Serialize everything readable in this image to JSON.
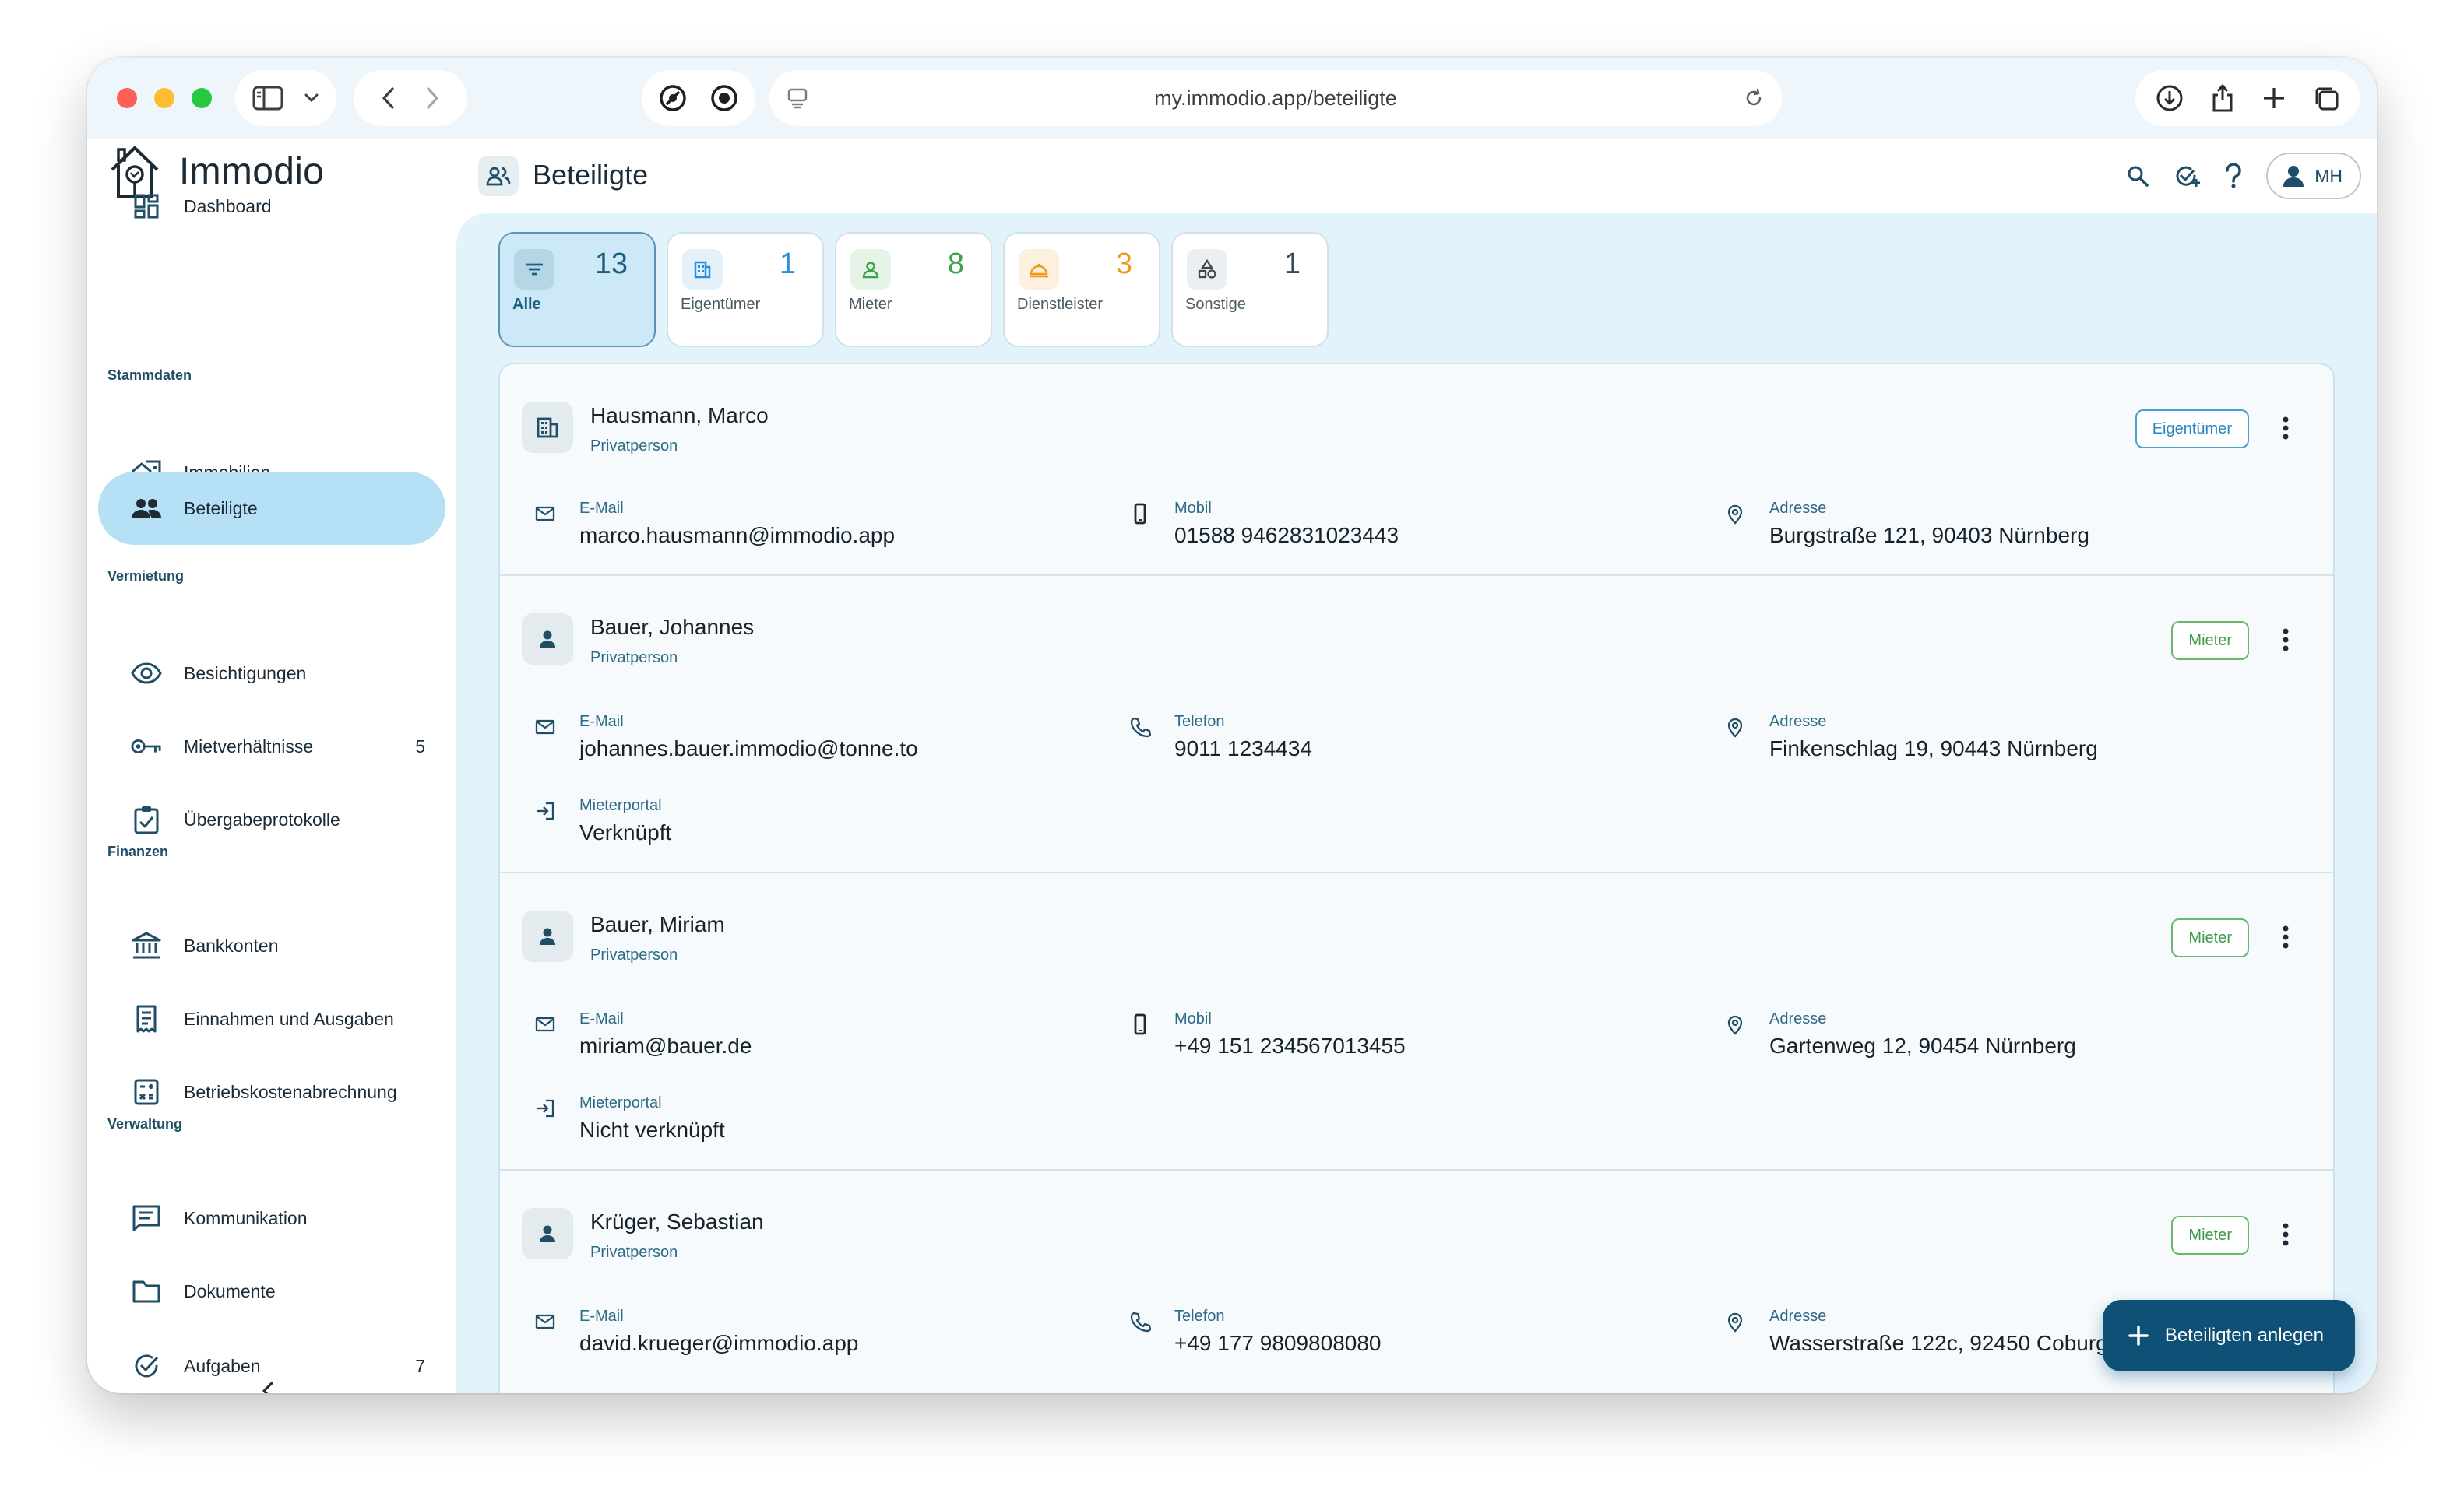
{
  "browser": {
    "url": "my.immodio.app/beteiligte"
  },
  "brand": {
    "name": "Immodio"
  },
  "sidebar": {
    "dashboard": "Dashboard",
    "sections": {
      "stammdaten": "Stammdaten",
      "vermietung": "Vermietung",
      "finanzen": "Finanzen",
      "verwaltung": "Verwaltung"
    },
    "items": {
      "immobilien": "Immobilien",
      "beteiligte": "Beteiligte",
      "besichtigungen": "Besichtigungen",
      "mietverhaeltnisse": "Mietverhältnisse",
      "mietverhaeltnisse_count": "5",
      "uebergabeprotokolle": "Übergabeprotokolle",
      "bankkonten": "Bankkonten",
      "einnahmen": "Einnahmen und Ausgaben",
      "betriebskosten": "Betriebskostenabrechnung",
      "kommunikation": "Kommunikation",
      "dokumente": "Dokumente",
      "aufgaben": "Aufgaben",
      "aufgaben_count": "7"
    }
  },
  "header": {
    "title": "Beteiligte",
    "user_initials": "MH"
  },
  "filters": [
    {
      "label": "Alle",
      "count": "13",
      "color": "#1c5f80"
    },
    {
      "label": "Eigentümer",
      "count": "1",
      "color": "#2b8fd6"
    },
    {
      "label": "Mieter",
      "count": "8",
      "color": "#3fa34d"
    },
    {
      "label": "Dienstleister",
      "count": "3",
      "color": "#f19a1a"
    },
    {
      "label": "Sonstige",
      "count": "1",
      "color": "#3b4750"
    }
  ],
  "people": [
    {
      "name": "Hausmann, Marco",
      "type": "Privatperson",
      "role": "Eigentümer",
      "email_label": "E-Mail",
      "email": "marco.hausmann@immodio.app",
      "phone_label": "Mobil",
      "phone": "01588 9462831023443",
      "address_label": "Adresse",
      "address": "Burgstraße  121, 90403 Nürnberg"
    },
    {
      "name": "Bauer, Johannes",
      "type": "Privatperson",
      "role": "Mieter",
      "email_label": "E-Mail",
      "email": "johannes.bauer.immodio@tonne.to",
      "phone_label": "Telefon",
      "phone": "9011 1234434",
      "address_label": "Adresse",
      "address": "Finkenschlag 19, 90443 Nürnberg",
      "portal_label": "Mieterportal",
      "portal": "Verknüpft"
    },
    {
      "name": "Bauer, Miriam",
      "type": "Privatperson",
      "role": "Mieter",
      "email_label": "E-Mail",
      "email": "miriam@bauer.de",
      "phone_label": "Mobil",
      "phone": "+49 151 234567013455",
      "address_label": "Adresse",
      "address": "Gartenweg 12, 90454 Nürnberg",
      "portal_label": "Mieterportal",
      "portal": "Nicht verknüpft"
    },
    {
      "name": "Krüger, Sebastian",
      "type": "Privatperson",
      "role": "Mieter",
      "email_label": "E-Mail",
      "email": "david.krueger@immodio.app",
      "phone_label": "Telefon",
      "phone": "+49 177 9809808080",
      "address_label": "Adresse",
      "address": "Wasserstraße 122c, 92450 Coburg"
    }
  ],
  "fab": {
    "label": "Beteiligten anlegen"
  }
}
